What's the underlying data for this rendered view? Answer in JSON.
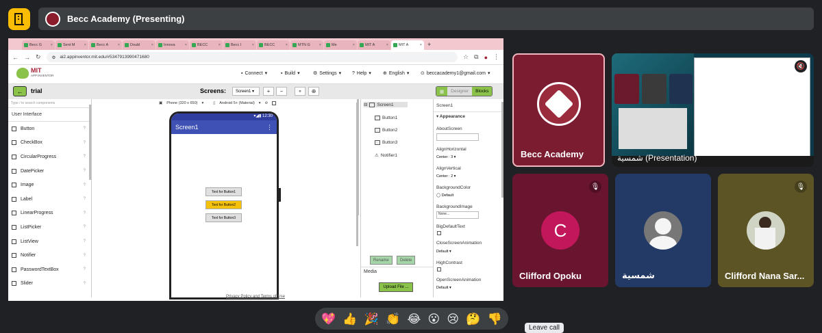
{
  "meeting": {
    "presenting_title": "Becc Academy (Presenting)"
  },
  "browser": {
    "tabs": [
      "Becc G",
      "Sent M",
      "Becc A",
      "Doubl",
      "Innova",
      "BECC",
      "Becc I",
      "BECC",
      "MTN G",
      "Me",
      "MIT A",
      "MIT A"
    ],
    "url": "ai2.appinventor.mit.edu/#5347913990471680"
  },
  "appinventor": {
    "logo_top": "MIT",
    "logo_bottom": "APP INVENTOR",
    "menu": {
      "connect": "Connect",
      "build": "Build",
      "settings": "Settings",
      "help": "Help",
      "language": "English",
      "account": "beccacademy1@gmail.com"
    },
    "project_name": "trial",
    "screens_label": "Screens:",
    "screen_select": "Screen1",
    "designer_label": "Designer",
    "blocks_label": "Blocks",
    "palette": {
      "search_placeholder": "Type / to search components",
      "category": "User Interface",
      "items": [
        "Button",
        "CheckBox",
        "CircularProgress",
        "DatePicker",
        "Image",
        "Label",
        "LinearProgress",
        "ListPicker",
        "ListView",
        "Notifier",
        "PasswordTextBox",
        "Slider"
      ]
    },
    "viewer": {
      "phone_size": "Phone (320 x 650)",
      "theme": "Android 5+ (Material)",
      "status_time": "12:30",
      "screen_title": "Screen1",
      "buttons": [
        "Text for Button1",
        "Text for Button2",
        "Text for Button3"
      ]
    },
    "tree": {
      "items": [
        "Screen1",
        "Button1",
        "Button2",
        "Button3",
        "Notifier1"
      ],
      "rename": "Rename",
      "delete": "Delete",
      "media": "Media",
      "upload": "Upload File ..."
    },
    "properties": {
      "component": "Screen1",
      "section": "Appearance",
      "about_screen": "AboutScreen",
      "align_horizontal": "AlignHorizontal",
      "align_horizontal_val": "Center : 3",
      "align_vertical": "AlignVertical",
      "align_vertical_val": "Center : 2",
      "background_color": "BackgroundColor",
      "background_color_val": "Default",
      "background_image": "BackgroundImage",
      "background_image_val": "None...",
      "big_default_text": "BigDefaultText",
      "close_screen_animation": "CloseScreenAnimation",
      "close_screen_animation_val": "Default",
      "high_contrast": "HighContrast",
      "open_screen_animation": "OpenScreenAnimation",
      "open_screen_animation_val": "Default"
    },
    "footer": "Privacy Policy and Terms of Use"
  },
  "participants": {
    "becc": "Becc Academy",
    "presentation": "شمسية (Presentation)",
    "clifford": "Clifford Opoku",
    "clifford_initial": "C",
    "shamsiya": "شمسية",
    "clifford_nana": "Clifford Nana Sar..."
  },
  "reactions": [
    "💖",
    "👍",
    "🎉",
    "👏",
    "😂",
    "😮",
    "😢",
    "🤔",
    "👎"
  ],
  "tooltip": "Leave call",
  "colors": {
    "background": "#202124",
    "becc_tile": "#7b1c30",
    "clifford_tile": "#6a1530",
    "shamsiya_tile": "#233a66",
    "nana_tile": "#5c5425",
    "accent": "#8bc34a"
  }
}
